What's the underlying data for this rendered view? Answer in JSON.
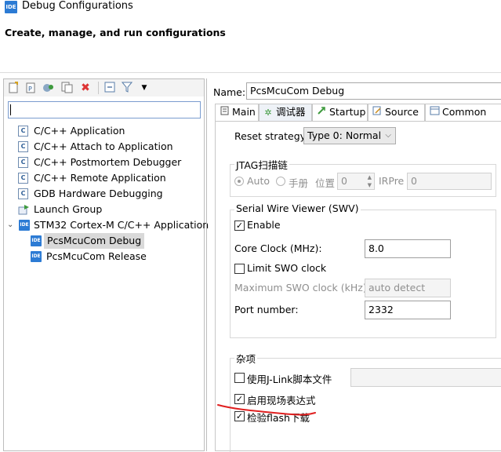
{
  "window": {
    "logo_text": "IDE",
    "title": "Debug Configurations",
    "subtitle": "Create, manage, and run configurations"
  },
  "toolbar": {
    "icons": [
      "new-config-icon",
      "new-prototype-icon",
      "export-icon",
      "duplicate-icon",
      "delete-icon",
      "collapse-all-icon",
      "filter-icon",
      "dropdown-arrow-icon"
    ]
  },
  "filter": {
    "value": ""
  },
  "tree": {
    "items": [
      {
        "label": "C/C++ Application"
      },
      {
        "label": "C/C++ Attach to Application"
      },
      {
        "label": "C/C++ Postmortem Debugger"
      },
      {
        "label": "C/C++ Remote Application"
      },
      {
        "label": "GDB Hardware Debugging"
      },
      {
        "label": "Launch Group"
      },
      {
        "label": "STM32 Cortex-M C/C++ Application"
      },
      {
        "label": "PcsMcuCom Debug"
      },
      {
        "label": "PcsMcuCom Release"
      }
    ]
  },
  "name": {
    "label": "Name:",
    "value": "PcsMcuCom Debug"
  },
  "tabs": [
    {
      "label": "Main"
    },
    {
      "label": "调试器"
    },
    {
      "label": "Startup"
    },
    {
      "label": "Source"
    },
    {
      "label": "Common"
    }
  ],
  "reset": {
    "label": "Reset strategy",
    "value": "Type 0: Normal"
  },
  "jtag": {
    "title": "JTAG扫描链",
    "auto_label": "Auto",
    "manual_label": "手册",
    "position_label": "位置",
    "position_value": "0",
    "irpre_label": "IRPre",
    "irpre_value": "0"
  },
  "swv": {
    "title": "Serial Wire Viewer (SWV)",
    "enable_label": "Enable",
    "core_clock_label": "Core Clock (MHz):",
    "core_clock_value": "8.0",
    "limit_label": "Limit SWO clock",
    "max_swo_label": "Maximum SWO clock (kHz):",
    "max_swo_value": "auto detect",
    "port_label": "Port number:",
    "port_value": "2332"
  },
  "misc": {
    "title": "杂项",
    "jlink_script_label": "使用J-Link脚本文件",
    "live_expr_label": "启用现场表达式",
    "verify_flash_label": "检验flash下载"
  },
  "colors": {
    "annotation_red": "#e02020",
    "logo_blue": "#2c7bd4"
  }
}
